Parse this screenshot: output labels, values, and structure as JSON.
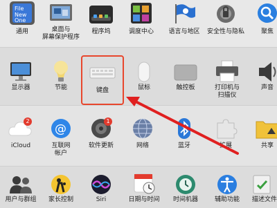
{
  "rows": [
    {
      "items": [
        {
          "label": "通用",
          "icon": "general-icon"
        },
        {
          "label": "桌面与\n屏幕保护程序",
          "icon": "desktop-icon"
        },
        {
          "label": "程序坞",
          "icon": "dock-icon"
        },
        {
          "label": "调度中心",
          "icon": "mission-control-icon"
        },
        {
          "label": "语言与地区",
          "icon": "language-icon"
        },
        {
          "label": "安全性与隐私",
          "icon": "security-icon"
        },
        {
          "label": "聚焦",
          "icon": "spotlight-icon"
        }
      ]
    },
    {
      "items": [
        {
          "label": "显示器",
          "icon": "display-icon"
        },
        {
          "label": "节能",
          "icon": "energy-icon"
        },
        {
          "label": "键盘",
          "icon": "keyboard-icon"
        },
        {
          "label": "鼠标",
          "icon": "mouse-icon"
        },
        {
          "label": "触控板",
          "icon": "trackpad-icon"
        },
        {
          "label": "打印机与\n扫描仪",
          "icon": "printer-icon"
        },
        {
          "label": "声音",
          "icon": "sound-icon"
        }
      ]
    },
    {
      "items": [
        {
          "label": "iCloud",
          "icon": "icloud-icon",
          "badge": "2"
        },
        {
          "label": "互联网\n帐户",
          "icon": "internet-accounts-icon"
        },
        {
          "label": "软件更新",
          "icon": "software-update-icon",
          "badge": "1"
        },
        {
          "label": "网络",
          "icon": "network-icon"
        },
        {
          "label": "蓝牙",
          "icon": "bluetooth-icon"
        },
        {
          "label": "扩展",
          "icon": "extensions-icon"
        },
        {
          "label": "共享",
          "icon": "sharing-icon"
        }
      ]
    },
    {
      "items": [
        {
          "label": "用户与群组",
          "icon": "users-icon"
        },
        {
          "label": "家长控制",
          "icon": "parental-icon"
        },
        {
          "label": "Siri",
          "icon": "siri-icon"
        },
        {
          "label": "日期与时间",
          "icon": "datetime-icon"
        },
        {
          "label": "时间机器",
          "icon": "timemachine-icon"
        },
        {
          "label": "辅助功能",
          "icon": "accessibility-icon"
        },
        {
          "label": "描述文件",
          "icon": "profiles-icon"
        }
      ]
    }
  ],
  "partial_icon_text": {
    "file": "File",
    "new": "New",
    "one": "One"
  },
  "accent": {
    "highlight": "#e8462c",
    "arrow": "#e02020",
    "badge": "#e23b2e"
  }
}
